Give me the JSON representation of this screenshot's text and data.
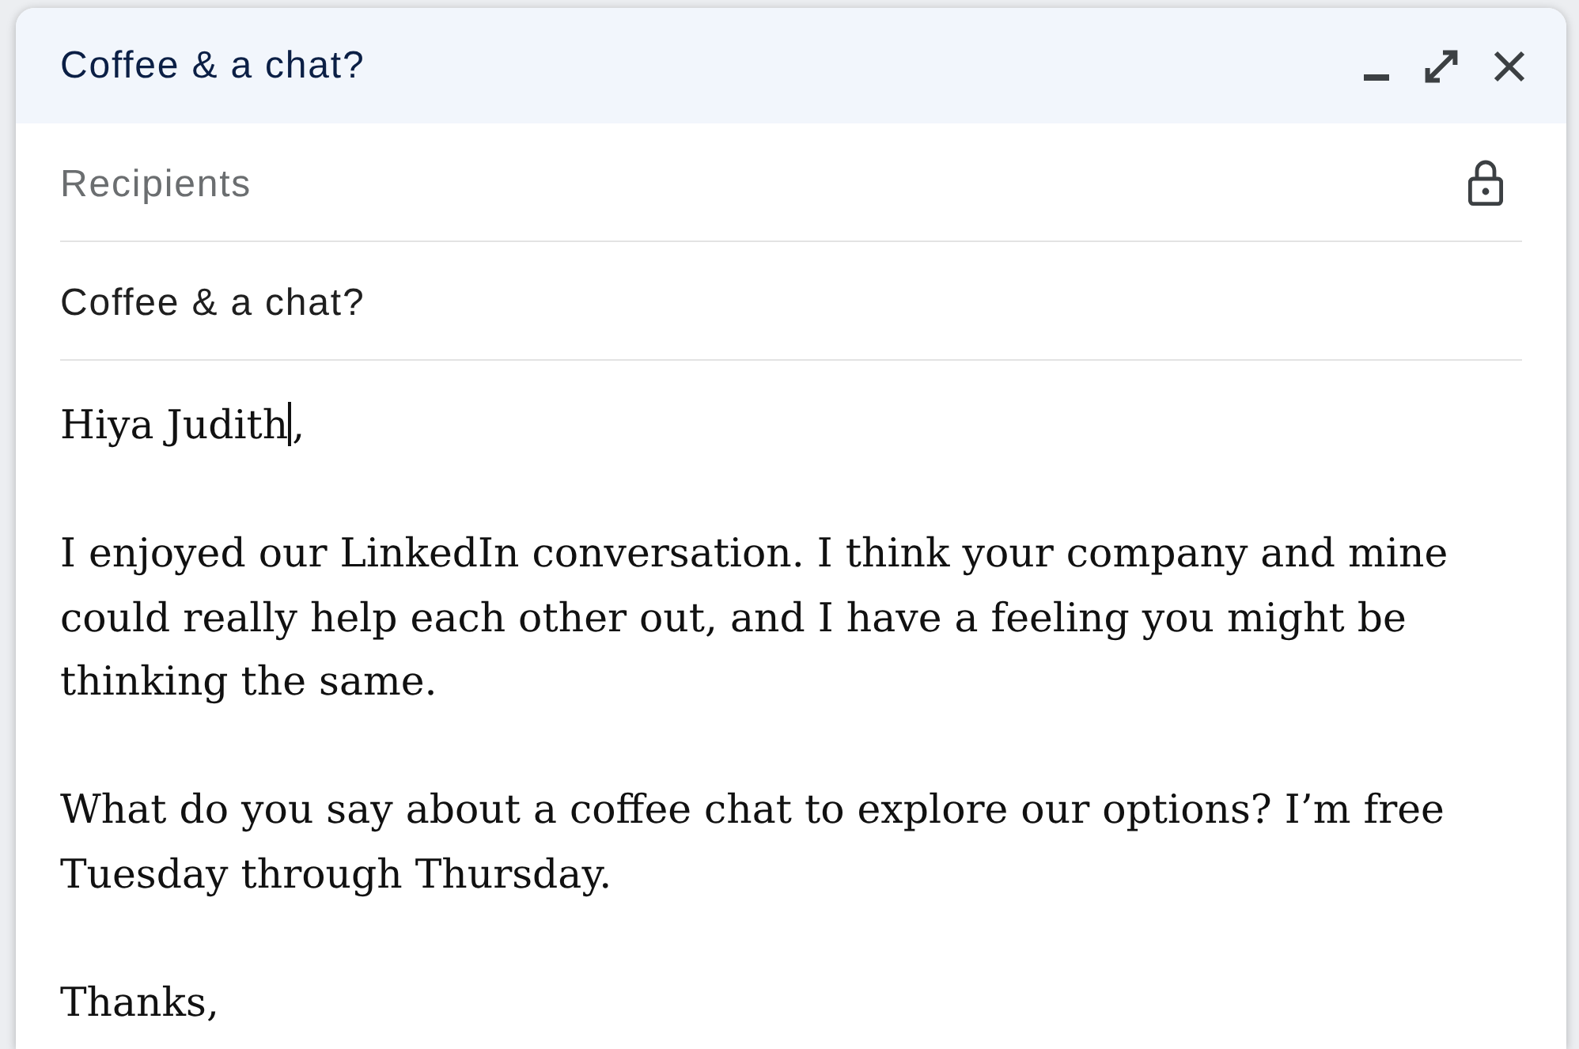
{
  "compose": {
    "title": "Coffee & a chat?",
    "recipients": {
      "placeholder": "Recipients"
    },
    "subject": {
      "value": "Coffee & a chat?"
    },
    "body": {
      "paragraphs": [
        {
          "text": "Hiya Judith",
          "after_cursor": ","
        },
        {
          "text": "I enjoyed our LinkedIn conversation. I think your company and mine could really help each other out, and I have a feeling you might be thinking the same."
        },
        {
          "text": "What do you say about a coffee chat to explore our options? I’m free Tuesday through Thursday."
        },
        {
          "text": "Thanks,"
        }
      ]
    }
  }
}
